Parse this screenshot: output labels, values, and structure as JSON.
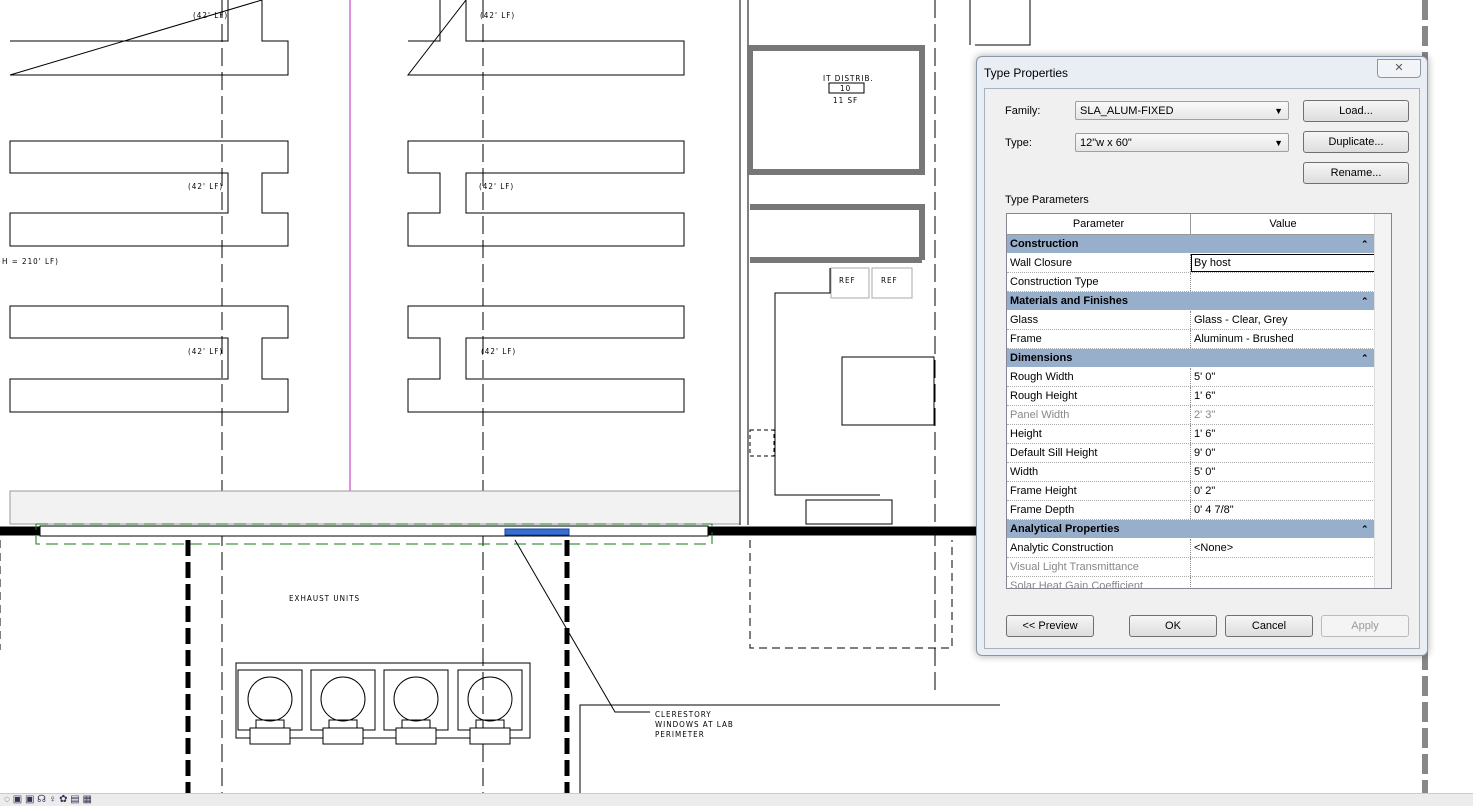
{
  "drawing": {
    "bench_labels": [
      "(42' LF)",
      "(42' LF)",
      "(42' LF)",
      "(42' LF)",
      "(42' LF)",
      "(42' LF)"
    ],
    "total_label": "H = 210' LF)",
    "room_name": "IT DISTRIB.",
    "room_number": "10",
    "room_area": "11 SF",
    "ref1": "REF",
    "ref2": "REF",
    "exhaust_label": "EXHAUST UNITS",
    "callout": [
      "CLERESTORY",
      "WINDOWS AT LAB",
      "PERIMETER"
    ]
  },
  "dialog": {
    "title": "Type Properties",
    "family_label": "Family:",
    "family_value": "SLA_ALUM-FIXED",
    "type_label": "Type:",
    "type_value": "12\"w x 60\"",
    "load": "Load...",
    "duplicate": "Duplicate...",
    "rename": "Rename...",
    "section": "Type Parameters",
    "col_param": "Parameter",
    "col_value": "Value",
    "rows": [
      {
        "g": "Construction"
      },
      {
        "p": "Wall Closure",
        "v": "By host"
      },
      {
        "p": "Construction Type",
        "v": ""
      },
      {
        "g": "Materials and Finishes"
      },
      {
        "p": "Glass",
        "v": "Glass - Clear, Grey"
      },
      {
        "p": "Frame",
        "v": "Aluminum - Brushed"
      },
      {
        "g": "Dimensions"
      },
      {
        "p": "Rough Width",
        "v": "5'  0\""
      },
      {
        "p": "Rough Height",
        "v": "1'  6\""
      },
      {
        "p": "Panel Width",
        "v": "2'  3\"",
        "dim": true
      },
      {
        "p": "Height",
        "v": "1'  6\""
      },
      {
        "p": "Default Sill Height",
        "v": "9'  0\""
      },
      {
        "p": "Width",
        "v": "5'  0\""
      },
      {
        "p": "Frame Height",
        "v": "0'  2\""
      },
      {
        "p": "Frame Depth",
        "v": "0'  4 7/8\""
      },
      {
        "g": "Analytical Properties"
      },
      {
        "p": "Analytic Construction",
        "v": "<None>"
      },
      {
        "p": "Visual Light Transmittance",
        "v": "",
        "dim": true
      },
      {
        "p": "Solar Heat Gain Coefficient",
        "v": "",
        "dim": true
      }
    ],
    "preview": "<< Preview",
    "ok": "OK",
    "cancel": "Cancel",
    "apply": "Apply"
  }
}
